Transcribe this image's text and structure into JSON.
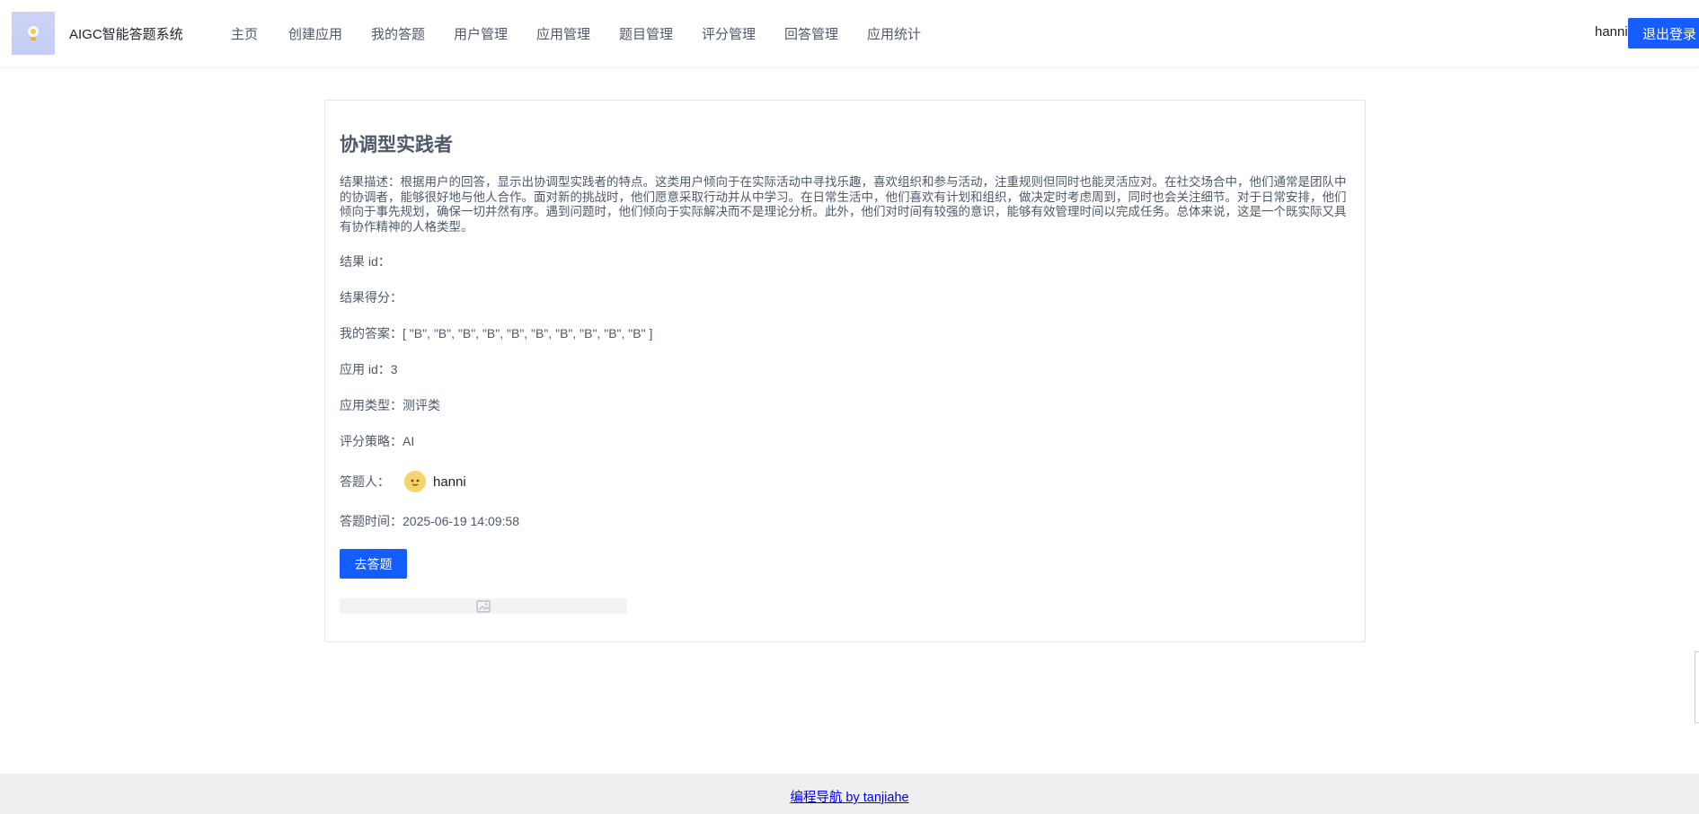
{
  "header": {
    "app_name": "AIGC智能答题系统",
    "nav": [
      "主页",
      "创建应用",
      "我的答题",
      "用户管理",
      "应用管理",
      "题目管理",
      "评分管理",
      "回答管理",
      "应用统计"
    ],
    "username": "hanni",
    "logout_label": "退出登录"
  },
  "result": {
    "title": "协调型实践者",
    "description": "结果描述：根据用户的回答，显示出协调型实践者的特点。这类用户倾向于在实际活动中寻找乐趣，喜欢组织和参与活动，注重规则但同时也能灵活应对。在社交场合中，他们通常是团队中的协调者，能够很好地与他人合作。面对新的挑战时，他们愿意采取行动并从中学习。在日常生活中，他们喜欢有计划和组织，做决定时考虑周到，同时也会关注细节。对于日常安排，他们倾向于事先规划，确保一切井然有序。遇到问题时，他们倾向于实际解决而不是理论分析。此外，他们对时间有较强的意识，能够有效管理时间以完成任务。总体来说，这是一个既实际又具有协作精神的人格类型。",
    "result_id": "结果 id：",
    "result_score": "结果得分：",
    "my_answers": "我的答案：[ \"B\", \"B\", \"B\", \"B\", \"B\", \"B\", \"B\", \"B\", \"B\", \"B\" ]",
    "app_id": "应用 id：3",
    "app_type": "应用类型：测评类",
    "scoring_strategy": "评分策略：AI",
    "answerer_label": "答题人：",
    "answerer_name": "hanni",
    "answer_time": "答题时间：2025-06-19 14:09:58",
    "go_answer_label": "去答题"
  },
  "footer": {
    "link_text": "编程导航 by tanjiahe"
  },
  "colors": {
    "primary": "#165dff",
    "footer_bg": "#efefef",
    "logo_bg": "#c5cdf3"
  }
}
